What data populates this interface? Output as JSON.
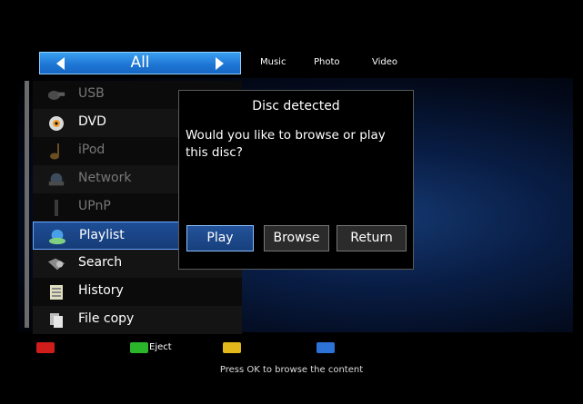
{
  "category_bar": {
    "selected": "All",
    "tabs": [
      "Music",
      "Photo",
      "Video"
    ]
  },
  "sidebar": {
    "items": [
      {
        "label": "USB",
        "icon": "usb-icon",
        "enabled": false
      },
      {
        "label": "DVD",
        "icon": "disc-icon",
        "enabled": true
      },
      {
        "label": "iPod",
        "icon": "music-note-icon",
        "enabled": false
      },
      {
        "label": "Network",
        "icon": "network-icon",
        "enabled": false
      },
      {
        "label": "UPnP",
        "icon": "upnp-icon",
        "enabled": false
      },
      {
        "label": "Playlist",
        "icon": "playlist-icon",
        "enabled": true,
        "selected": true
      },
      {
        "label": "Search",
        "icon": "search-icon",
        "enabled": true
      },
      {
        "label": "History",
        "icon": "history-icon",
        "enabled": true
      },
      {
        "label": "File copy",
        "icon": "file-copy-icon",
        "enabled": true
      }
    ]
  },
  "dialog": {
    "title": "Disc detected",
    "message": "Would you like to browse or play this disc?",
    "buttons": {
      "play": "Play",
      "browse": "Browse",
      "return": "Return"
    },
    "selected_button": "play"
  },
  "footer": {
    "color_keys": {
      "red": "#d11c1c",
      "green": "#2bb52b",
      "yellow": "#e2b81a",
      "blue": "#2d72d9"
    },
    "green_label": "Eject",
    "hint": "Press OK to browse the content"
  },
  "colors": {
    "accent": "#1f77d6",
    "selection": "#1e4e96"
  }
}
